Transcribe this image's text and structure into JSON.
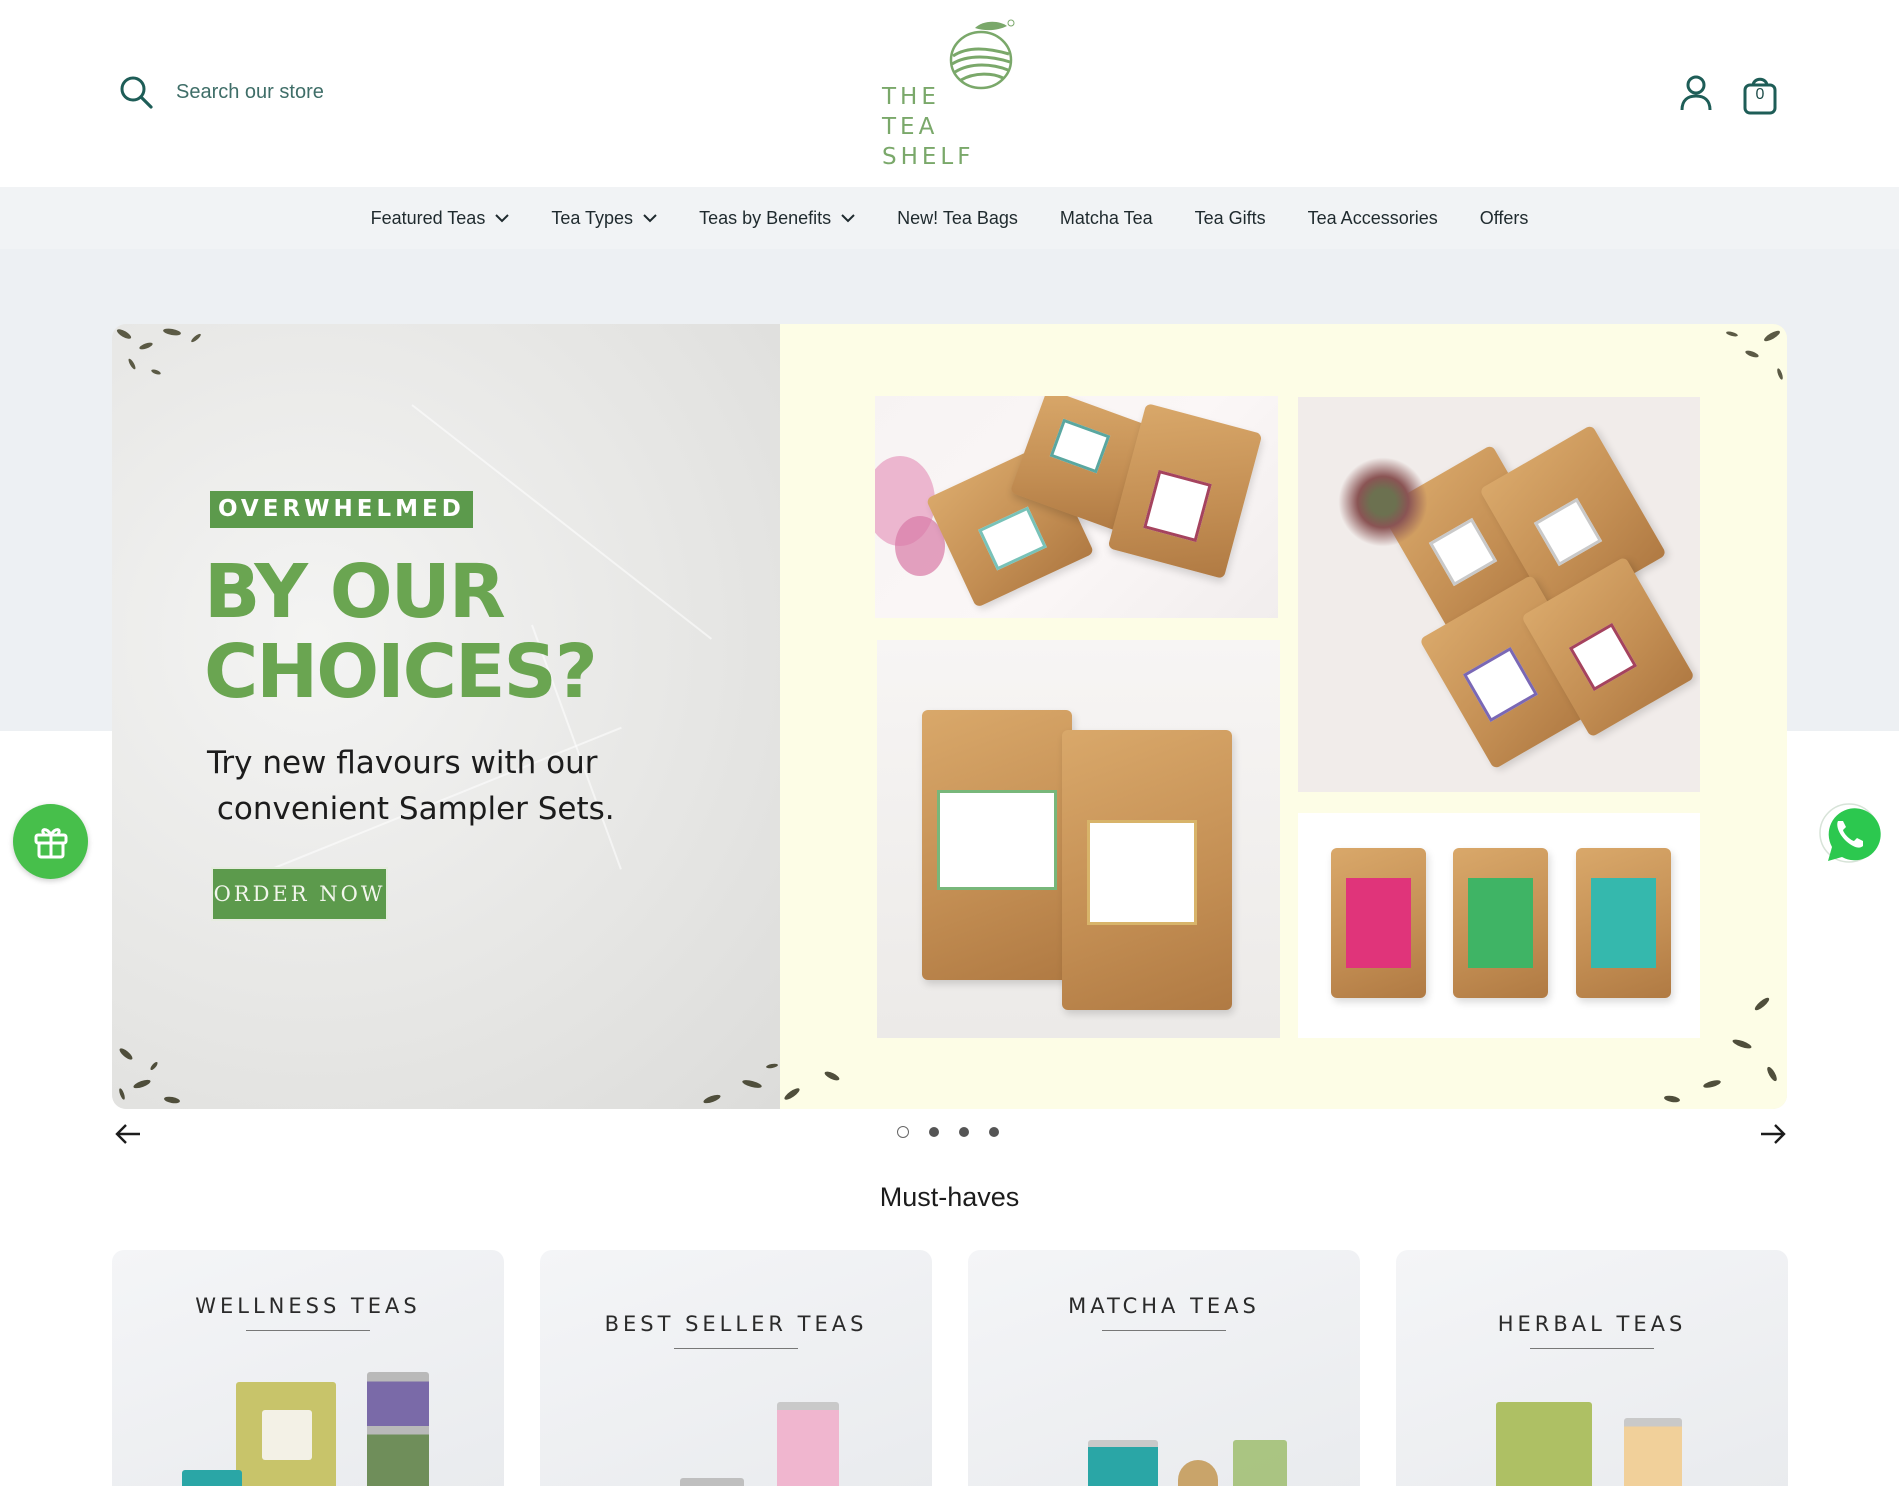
{
  "header": {
    "search_placeholder": "Search our store",
    "logo_lines": [
      "THE",
      "TEA",
      "SHELF"
    ],
    "cart_count": "0"
  },
  "nav": {
    "items": [
      {
        "label": "Featured Teas",
        "has_dropdown": true
      },
      {
        "label": "Tea Types",
        "has_dropdown": true
      },
      {
        "label": "Teas by Benefits",
        "has_dropdown": true
      },
      {
        "label": "New! Tea Bags",
        "has_dropdown": false
      },
      {
        "label": "Matcha Tea",
        "has_dropdown": false
      },
      {
        "label": "Tea Gifts",
        "has_dropdown": false
      },
      {
        "label": "Tea Accessories",
        "has_dropdown": false
      },
      {
        "label": "Offers",
        "has_dropdown": false
      }
    ]
  },
  "hero": {
    "tag": "OVERWHELMED",
    "headline_line1": "BY OUR",
    "headline_line2": "CHOICES?",
    "subline_line1": "Try new flavours with our",
    "subline_line2": " convenient Sampler Sets.",
    "cta_label": "ORDER NOW",
    "accent_color": "#5c9a4c"
  },
  "carousel": {
    "slide_count": 4,
    "active_index": 0
  },
  "must_haves": {
    "title": "Must-haves",
    "cards": [
      {
        "title": "WELLNESS TEAS"
      },
      {
        "title": "BEST SELLER TEAS"
      },
      {
        "title": "MATCHA TEAS"
      },
      {
        "title": "HERBAL TEAS"
      }
    ]
  },
  "icons": {
    "search": "search-icon",
    "account": "account-icon",
    "cart": "cart-icon",
    "gift": "gift-icon",
    "whatsapp": "whatsapp-icon"
  }
}
